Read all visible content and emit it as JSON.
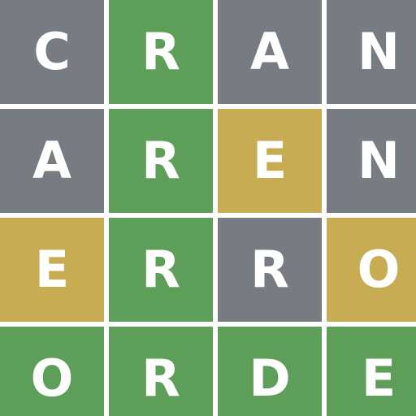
{
  "colors": {
    "correct": "#5d9e58",
    "present": "#c7ac54",
    "absent": "#777b82",
    "background": "#ffffff"
  },
  "board": {
    "rows": [
      {
        "tiles": [
          {
            "letter": "C",
            "state": "absent"
          },
          {
            "letter": "R",
            "state": "correct"
          },
          {
            "letter": "A",
            "state": "absent"
          },
          {
            "letter": "N",
            "state": "absent"
          }
        ]
      },
      {
        "tiles": [
          {
            "letter": "A",
            "state": "absent"
          },
          {
            "letter": "R",
            "state": "correct"
          },
          {
            "letter": "E",
            "state": "present"
          },
          {
            "letter": "N",
            "state": "absent"
          }
        ]
      },
      {
        "tiles": [
          {
            "letter": "E",
            "state": "present"
          },
          {
            "letter": "R",
            "state": "correct"
          },
          {
            "letter": "R",
            "state": "absent"
          },
          {
            "letter": "O",
            "state": "present"
          }
        ]
      },
      {
        "tiles": [
          {
            "letter": "O",
            "state": "correct"
          },
          {
            "letter": "R",
            "state": "correct"
          },
          {
            "letter": "D",
            "state": "correct"
          },
          {
            "letter": "E",
            "state": "correct"
          }
        ]
      }
    ]
  }
}
